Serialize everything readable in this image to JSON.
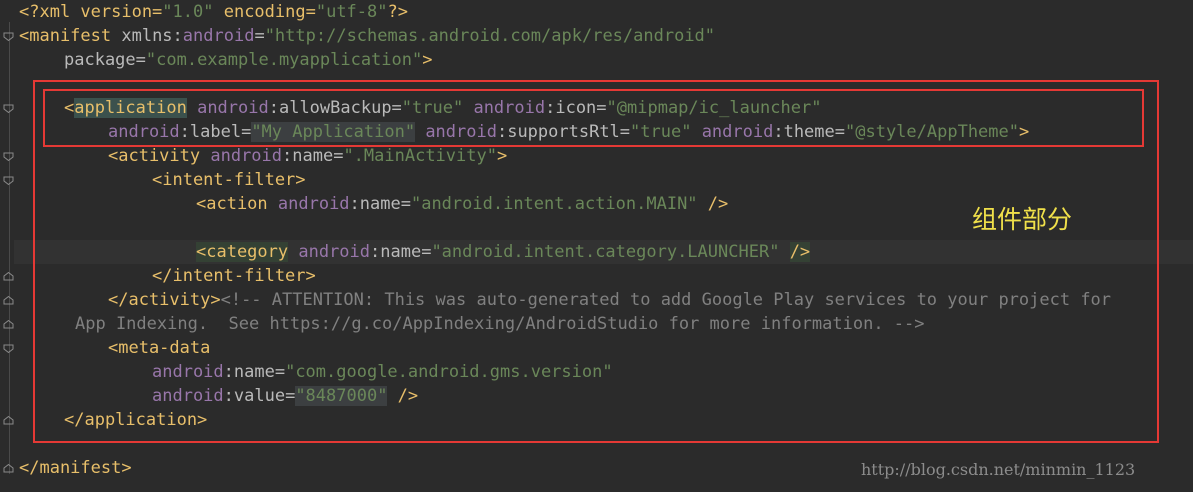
{
  "editor": {
    "lines": {
      "l1": {
        "a": "<?xml version=",
        "b": "\"1.0\"",
        "c": " encoding=",
        "d": "\"utf-8\"",
        "e": "?>"
      },
      "l2": {
        "a": "<manifest ",
        "b": "xmlns:",
        "c": "android",
        "d": "=",
        "e": "\"http://schemas.android.com/apk/res/android\""
      },
      "l3": {
        "a": "package=",
        "b": "\"com.example.myapplication\"",
        "c": ">"
      },
      "l5": {
        "a": "<",
        "b": "application",
        "c": " android",
        "d": ":allowBackup=",
        "e": "\"true\"",
        "f": " android",
        "g": ":icon=",
        "h": "\"@mipmap/ic_launcher\""
      },
      "l6": {
        "a": "android",
        "b": ":label=",
        "c": "\"My Application\"",
        "d": " android",
        "e": ":supportsRtl=",
        "f": "\"true\"",
        "g": " android",
        "h": ":theme=",
        "i": "\"@style/AppTheme\"",
        "j": ">"
      },
      "l7": {
        "a": "<activity",
        "b": " android",
        "c": ":name=",
        "d": "\".MainActivity\"",
        "e": ">"
      },
      "l8": {
        "a": "<intent-filter>"
      },
      "l9": {
        "a": "<action",
        "b": " android",
        "c": ":name=",
        "d": "\"android.intent.action.MAIN\"",
        "e": " />"
      },
      "l11": {
        "a": "<category",
        "b": " android",
        "c": ":name=",
        "d": "\"android.intent.category.LAUNCHER\"",
        "e": " ",
        "f": "/>"
      },
      "l12": {
        "a": "</intent-filter>"
      },
      "l13": {
        "a": "</activity>",
        "b": "<!-- ATTENTION: This was auto-generated to add Google Play services to your project for"
      },
      "l14": {
        "a": "App Indexing.  See https://g.co/AppIndexing/AndroidStudio for more information. -->"
      },
      "l15": {
        "a": "<meta-data"
      },
      "l16": {
        "a": "android",
        "b": ":name=",
        "c": "\"com.google.android.gms.version\""
      },
      "l17": {
        "a": "android",
        "b": ":value=",
        "c": "\"8487000\"",
        "d": " />"
      },
      "l18": {
        "a": "</application>"
      },
      "l20": {
        "a": "</manifest>"
      }
    }
  },
  "annotation": {
    "label": "组件部分"
  },
  "watermark": {
    "text": "http://blog.csdn.net/minmin_1123"
  },
  "colors": {
    "background": "#2b2b2b",
    "tag": "#e8bf6a",
    "namespace": "#9876aa",
    "attribute": "#bababa",
    "string": "#6a8759",
    "comment": "#808080",
    "highlight_box": "#e53935",
    "annotation": "#f0e04a"
  }
}
